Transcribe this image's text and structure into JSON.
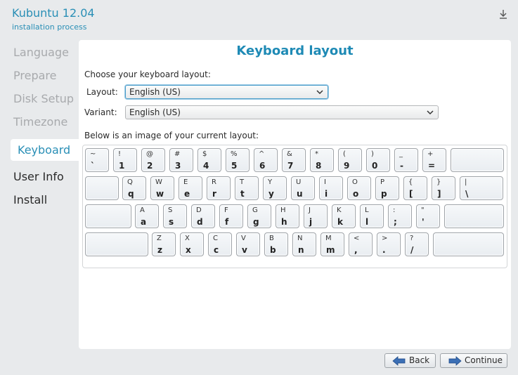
{
  "app": {
    "title": "Kubuntu 12.04",
    "subtitle": "installation process",
    "top_icon": "download-arrow-icon"
  },
  "sidebar": {
    "items": [
      {
        "label": "Language",
        "state": "pending"
      },
      {
        "label": "Prepare",
        "state": "pending"
      },
      {
        "label": "Disk Setup",
        "state": "pending"
      },
      {
        "label": "Timezone",
        "state": "pending"
      },
      {
        "label": "Keyboard",
        "state": "active"
      },
      {
        "label": "User Info",
        "state": "done"
      },
      {
        "label": "Install",
        "state": "done"
      }
    ]
  },
  "panel": {
    "title": "Keyboard layout",
    "prompt": "Choose your keyboard layout:",
    "layout_label": "Layout:",
    "layout_value": "English (US)",
    "variant_label": "Variant:",
    "variant_value": "English (US)",
    "image_caption": "Below is an image of your current layout:"
  },
  "keyboard": {
    "rows": [
      [
        [
          "~",
          "`"
        ],
        [
          "!",
          "1"
        ],
        [
          "@",
          "2"
        ],
        [
          "#",
          "3"
        ],
        [
          "$",
          "4"
        ],
        [
          "%",
          "5"
        ],
        [
          "^",
          "6"
        ],
        [
          "&",
          "7"
        ],
        [
          "*",
          "8"
        ],
        [
          "(",
          "9"
        ],
        [
          ")",
          "0"
        ],
        [
          "_",
          "-"
        ],
        [
          "+",
          "="
        ]
      ],
      [
        [
          "Q",
          "q"
        ],
        [
          "W",
          "w"
        ],
        [
          "E",
          "e"
        ],
        [
          "R",
          "r"
        ],
        [
          "T",
          "t"
        ],
        [
          "Y",
          "y"
        ],
        [
          "U",
          "u"
        ],
        [
          "I",
          "i"
        ],
        [
          "O",
          "o"
        ],
        [
          "P",
          "p"
        ],
        [
          "{",
          "["
        ],
        [
          "}",
          "]"
        ],
        [
          "|",
          "\\"
        ]
      ],
      [
        [
          "A",
          "a"
        ],
        [
          "S",
          "s"
        ],
        [
          "D",
          "d"
        ],
        [
          "F",
          "f"
        ],
        [
          "G",
          "g"
        ],
        [
          "H",
          "h"
        ],
        [
          "J",
          "j"
        ],
        [
          "K",
          "k"
        ],
        [
          "L",
          "l"
        ],
        [
          ":",
          ";"
        ],
        [
          "\"",
          "'"
        ]
      ],
      [
        [
          "Z",
          "z"
        ],
        [
          "X",
          "x"
        ],
        [
          "C",
          "c"
        ],
        [
          "V",
          "v"
        ],
        [
          "B",
          "b"
        ],
        [
          "N",
          "n"
        ],
        [
          "M",
          "m"
        ],
        [
          "<",
          ","
        ],
        [
          ">",
          "."
        ],
        [
          "?",
          "/"
        ]
      ]
    ]
  },
  "footer": {
    "back_label": "Back",
    "continue_label": "Continue",
    "back_icon": "arrow-left-icon",
    "continue_icon": "arrow-right-icon"
  },
  "colors": {
    "accent": "#2a8fb6",
    "inactive": "#a8aaad",
    "arrow_fill": "#3b6fb5"
  }
}
